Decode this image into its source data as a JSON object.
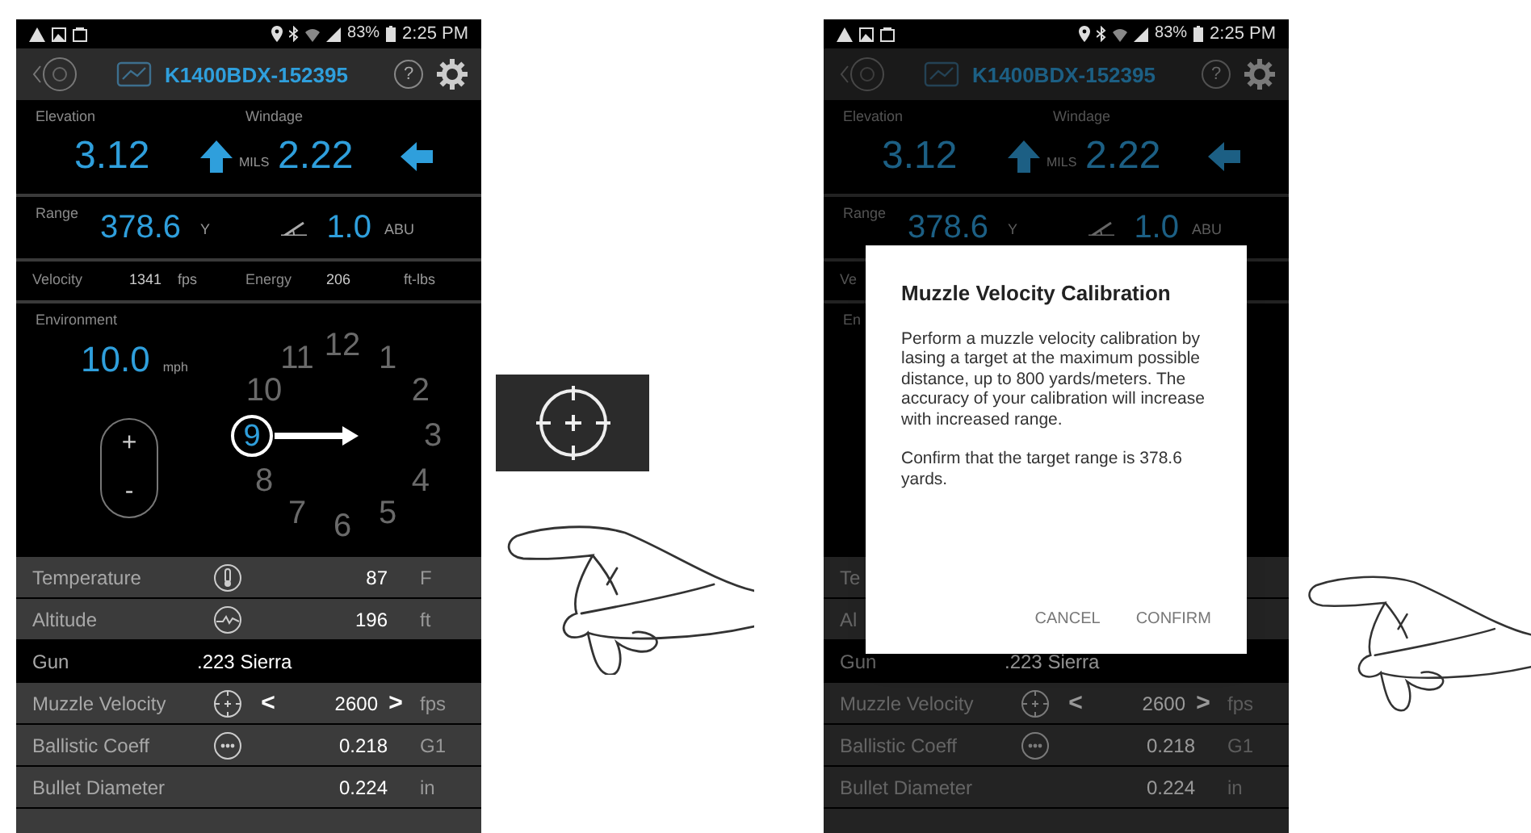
{
  "screens": [
    {
      "dimmed": false,
      "status_bar": {
        "battery": "83%",
        "time": "2:25 PM"
      },
      "header": {
        "title": "K1400BDX-152395",
        "help": "?"
      },
      "solution": {
        "elevation_label": "Elevation",
        "windage_label": "Windage",
        "elevation": "3.12",
        "unit": "MILS",
        "windage": "2.22"
      },
      "range": {
        "label": "Range",
        "value": "378.6",
        "unit": "Y",
        "angle": "1.0",
        "angle_unit": "ABU"
      },
      "velocity": {
        "label": "Velocity",
        "value": "1341",
        "unit": "fps",
        "energy_label": "Energy",
        "energy": "206",
        "energy_unit": "ft-lbs"
      },
      "environment": {
        "label": "Environment",
        "wind_speed": "10.0",
        "wind_unit": "mph",
        "plus": "+",
        "minus": "-",
        "clock": [
          {
            "label": "11",
            "selected": false
          },
          {
            "label": "12",
            "selected": false
          },
          {
            "label": "1",
            "selected": false
          },
          {
            "label": "10",
            "selected": false
          },
          {
            "label": "2",
            "selected": false
          },
          {
            "label": "9",
            "selected": true
          },
          {
            "label": "3",
            "selected": false
          },
          {
            "label": "8",
            "selected": false
          },
          {
            "label": "4",
            "selected": false
          },
          {
            "label": "7",
            "selected": false
          },
          {
            "label": "5",
            "selected": false
          },
          {
            "label": "6",
            "selected": false
          }
        ]
      },
      "rows": [
        {
          "kind": "value",
          "label": "Temperature",
          "value": "87",
          "unit": "F"
        },
        {
          "kind": "value",
          "label": "Altitude",
          "value": "196",
          "unit": "ft"
        },
        {
          "kind": "gun",
          "label": "Gun",
          "value": ".223 Sierra"
        },
        {
          "kind": "stepper",
          "label": "Muzzle Velocity",
          "prev": "<",
          "value": "2600",
          "next": ">",
          "unit": "fps"
        },
        {
          "kind": "value",
          "label": "Ballistic Coeff",
          "value": "0.218",
          "unit": "G1"
        },
        {
          "kind": "value",
          "label": "Bullet Diameter",
          "value": "0.224",
          "unit": "in"
        }
      ]
    },
    {
      "dimmed": true,
      "status_bar": {
        "battery": "83%",
        "time": "2:25 PM"
      },
      "header": {
        "title": "K1400BDX-152395",
        "help": "?"
      },
      "solution": {
        "elevation_label": "Elevation",
        "windage_label": "Windage",
        "elevation": "3.12",
        "unit": "MILS",
        "windage": "2.22"
      },
      "range": {
        "label": "Range",
        "value": "378.6",
        "unit": "Y",
        "angle": "1.0",
        "angle_unit": "ABU"
      },
      "velocity": {
        "label": "Ve"
      },
      "environment": {
        "label": "En"
      },
      "rows": [
        {
          "kind": "value",
          "label": "Te"
        },
        {
          "kind": "value",
          "label": "Al"
        },
        {
          "kind": "gun",
          "label": "Gun",
          "value": ".223 Sierra"
        },
        {
          "kind": "stepper",
          "label": "Muzzle Velocity",
          "prev": "<",
          "value": "2600",
          "next": ">",
          "unit": "fps"
        },
        {
          "kind": "value",
          "label": "Ballistic Coeff",
          "value": "0.218",
          "unit": "G1"
        },
        {
          "kind": "value",
          "label": "Bullet Diameter",
          "value": "0.224",
          "unit": "in"
        }
      ],
      "dialog": {
        "title": "Muzzle Velocity Calibration",
        "paragraphs": [
          "Perform a muzzle velocity calibration by lasing a target at the maximum possible distance, up to 800 yards/meters. The accuracy of your calibration will increase with increased range.",
          "Confirm that the target range is 378.6 yards."
        ],
        "buttons": [
          "CANCEL",
          "CONFIRM"
        ]
      }
    }
  ]
}
